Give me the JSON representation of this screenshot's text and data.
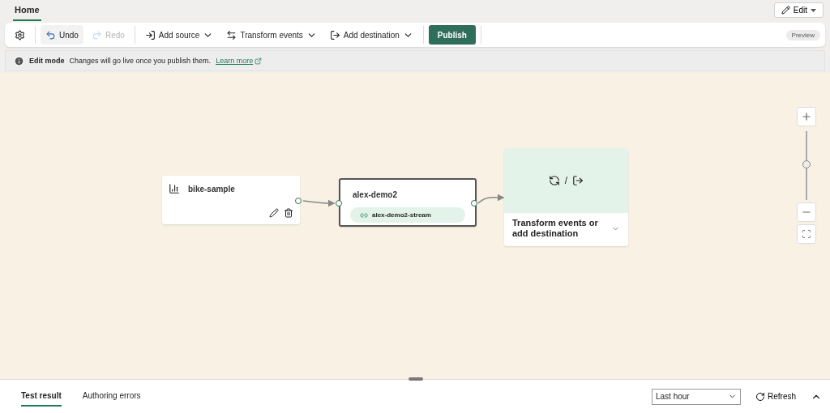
{
  "tabs": [
    {
      "label": "Home",
      "selected": true
    }
  ],
  "edit_button": {
    "label": "Edit"
  },
  "toolbar": {
    "items": [
      {
        "kind": "settings"
      },
      {
        "kind": "undo",
        "label": "Undo",
        "disabled": false
      },
      {
        "kind": "redo",
        "label": "Redo",
        "disabled": true
      },
      {
        "kind": "menu",
        "label": "Add source"
      },
      {
        "kind": "menu",
        "label": "Transform events"
      },
      {
        "kind": "menu",
        "label": "Add destination"
      },
      {
        "kind": "primary",
        "label": "Publish"
      }
    ],
    "badge": "Preview"
  },
  "info_bar": {
    "title": "Edit mode",
    "message": "Changes will go live once you publish them.",
    "link": "Learn more"
  },
  "canvas": {
    "source": {
      "name": "bike-sample"
    },
    "stream": {
      "name": "alex-demo2",
      "chip": "alex-demo2-stream"
    },
    "destination": {
      "separator": "/",
      "label": "Transform events or add destination"
    },
    "zoom": {
      "level": 0.52
    }
  },
  "bottom_panel": {
    "tabs": [
      {
        "label": "Test result",
        "selected": true
      },
      {
        "label": "Authoring errors",
        "selected": false
      }
    ],
    "time_range": "Last hour",
    "refresh": "Refresh"
  }
}
